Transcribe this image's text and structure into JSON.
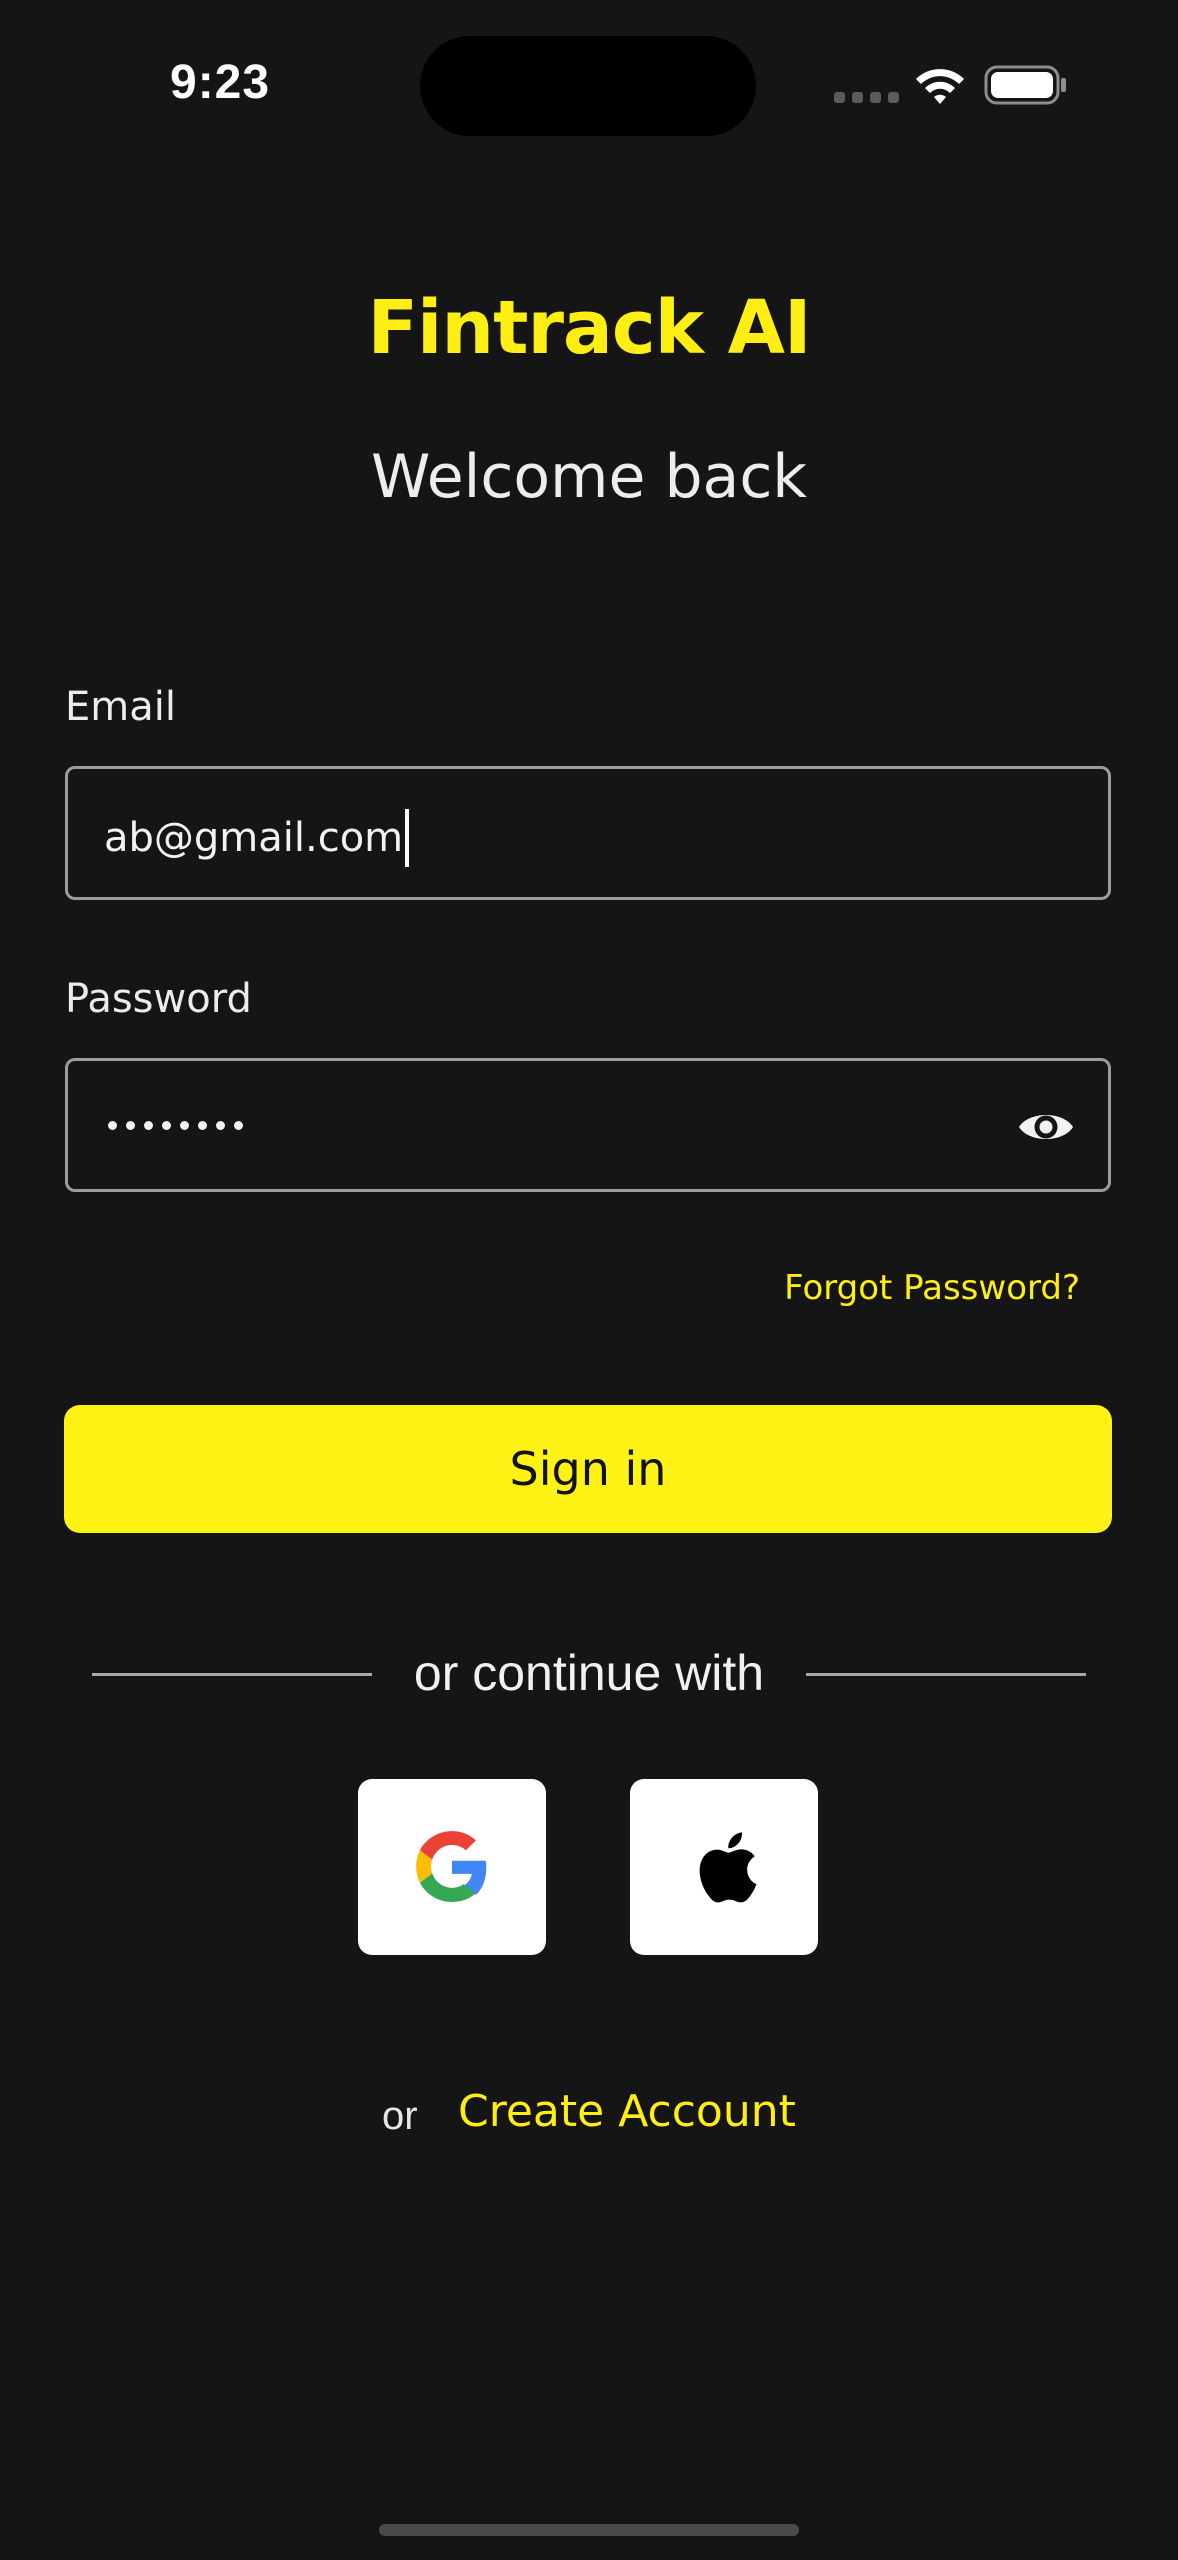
{
  "status_bar": {
    "time": "9:23"
  },
  "header": {
    "app_title": "Fintrack AI",
    "subtitle": "Welcome back"
  },
  "form": {
    "email_label": "Email",
    "email_value": "ab@gmail.com",
    "password_label": "Password",
    "password_mask_length": 8,
    "forgot_password": "Forgot Password?",
    "signin_label": "Sign in"
  },
  "divider": {
    "text": "or continue with"
  },
  "social": {
    "google_icon": "google-icon",
    "apple_icon": "apple-icon"
  },
  "footer": {
    "or_text": "or",
    "create_account": "Create Account"
  },
  "colors": {
    "background": "#151515",
    "accent": "#ffee14",
    "button": "#fff315"
  }
}
